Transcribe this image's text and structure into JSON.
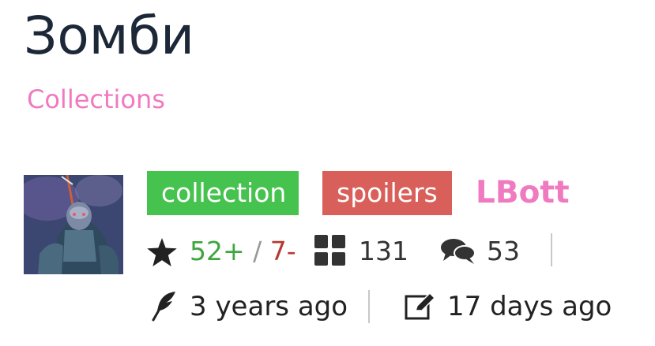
{
  "page": {
    "title": "Зомби",
    "breadcrumb": "Collections"
  },
  "tags": [
    {
      "label": "collection",
      "color": "#46c24e"
    },
    {
      "label": "spoilers",
      "color": "#d9605a"
    }
  ],
  "author": "LBott",
  "stats": {
    "upvotes": "52+",
    "separator": "/",
    "downvotes": "7-",
    "items": "131",
    "comments": "53"
  },
  "times": {
    "created": "3 years ago",
    "updated": "17 days ago"
  },
  "icons": [
    "star-icon",
    "grid-icon",
    "comments-icon",
    "feather-icon",
    "edit-icon"
  ],
  "colors": {
    "accent": "#f07ac0",
    "title": "#1c2838",
    "upvote": "#3fa63f",
    "downvote": "#b33a32"
  }
}
